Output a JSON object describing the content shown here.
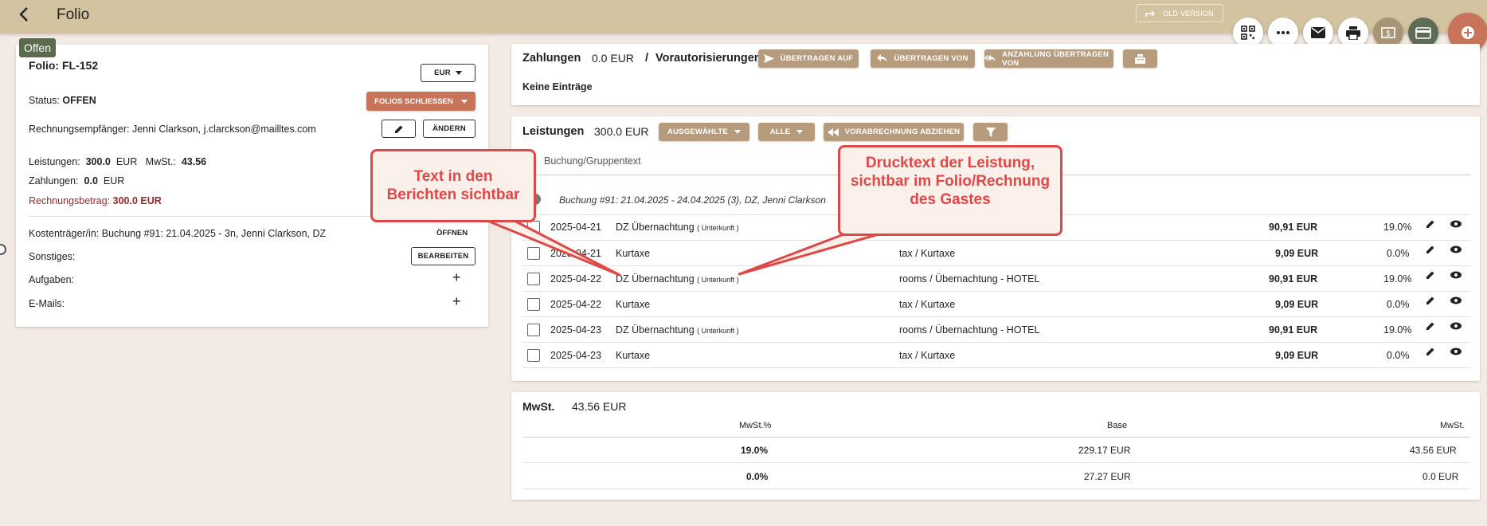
{
  "app": {
    "title": "Folio",
    "old_version_label": "OLD VERSION"
  },
  "status_chip": "Offen",
  "folio": {
    "title": "Folio: FL-152",
    "currency": "EUR",
    "status_label": "Status:",
    "status_value": "OFFEN",
    "close_button": "FOLIOS SCHLIESSEN",
    "recipient_label": "Rechnungsempfänger:",
    "recipient_value": "Jenni Clarkson, j.clarckson@mailltes.com",
    "change_button": "ÄNDERN",
    "services_label": "Leistungen:",
    "services_value": "300.0",
    "services_currency": "EUR",
    "vat_label": "MwSt.:",
    "vat_value": "43.56",
    "payments_label": "Zahlungen:",
    "payments_value": "0.0",
    "payments_currency": "EUR",
    "invoice_label": "Rechnungsbetrag:",
    "invoice_value": "300.0 EUR",
    "cost_bearer_label": "Kostenträger/in:",
    "cost_bearer_value": "Buchung #91: 21.04.2025 - 3n, Jenni Clarkson, DZ",
    "open_button": "ÖFFNEN",
    "misc_label": "Sonstiges:",
    "edit_button": "BEARBEITEN",
    "tasks_label": "Aufgaben:",
    "emails_label": "E-Mails:",
    "plus": "+"
  },
  "payments": {
    "title": "Zahlungen",
    "amount": "0.0 EUR",
    "slash": "/",
    "preauth": "Vorautorisierungen",
    "btn_transfer_to": "ÜBERTRAGEN AUF",
    "btn_transfer_from": "ÜBERTRAGEN VON",
    "btn_deposit": "ANZAHLUNG ÜBERTRAGEN VON",
    "empty": "Keine Einträge"
  },
  "services": {
    "title": "Leistungen",
    "amount": "300.0 EUR",
    "btn_selected": "AUSGEWÄHLTE",
    "btn_all": "ALLE",
    "btn_deduct": "VORABRECHNUNG ABZIEHEN",
    "column_header": "Buchung/Gruppentext",
    "group_text": "Buchung #91: 21.04.2025 - 24.04.2025 (3), DZ, Jenni Clarkson",
    "rows": [
      {
        "date": "2025-04-21",
        "name": "DZ Übernachtung",
        "sub": "( Unterkunft )",
        "category": "",
        "amount": "90,91 EUR",
        "vat": "19.0%"
      },
      {
        "date": "2025-04-21",
        "name": "Kurtaxe",
        "sub": "",
        "category": "tax / Kurtaxe",
        "amount": "9,09 EUR",
        "vat": "0.0%"
      },
      {
        "date": "2025-04-22",
        "name": "DZ Übernachtung",
        "sub": "( Unterkunft )",
        "category": "rooms / Übernachtung - HOTEL",
        "amount": "90,91 EUR",
        "vat": "19.0%"
      },
      {
        "date": "2025-04-22",
        "name": "Kurtaxe",
        "sub": "",
        "category": "tax / Kurtaxe",
        "amount": "9,09 EUR",
        "vat": "0.0%"
      },
      {
        "date": "2025-04-23",
        "name": "DZ Übernachtung",
        "sub": "( Unterkunft )",
        "category": "rooms / Übernachtung - HOTEL",
        "amount": "90,91 EUR",
        "vat": "19.0%"
      },
      {
        "date": "2025-04-23",
        "name": "Kurtaxe",
        "sub": "",
        "category": "tax / Kurtaxe",
        "amount": "9,09 EUR",
        "vat": "0.0%"
      }
    ]
  },
  "vat": {
    "title": "MwSt.",
    "amount": "43.56 EUR",
    "headers": [
      "MwSt.%",
      "Base",
      "MwSt."
    ],
    "rows": [
      {
        "rate": "19.0%",
        "base": "229.17 EUR",
        "vat": "43.56 EUR"
      },
      {
        "rate": "0.0%",
        "base": "27.27 EUR",
        "vat": "0.0 EUR"
      }
    ]
  },
  "callouts": {
    "left": "Text in den Berichten sichtbar",
    "right": "Drucktext der Leistung, sichtbar im Folio/Rechnung des Gastes"
  },
  "colors": {
    "topbar": "#d3c3a0",
    "accent_tan": "#b69c7c",
    "accent_rust": "#c8745b",
    "invoice_red": "#a02828",
    "callout_red": "#e04848"
  }
}
